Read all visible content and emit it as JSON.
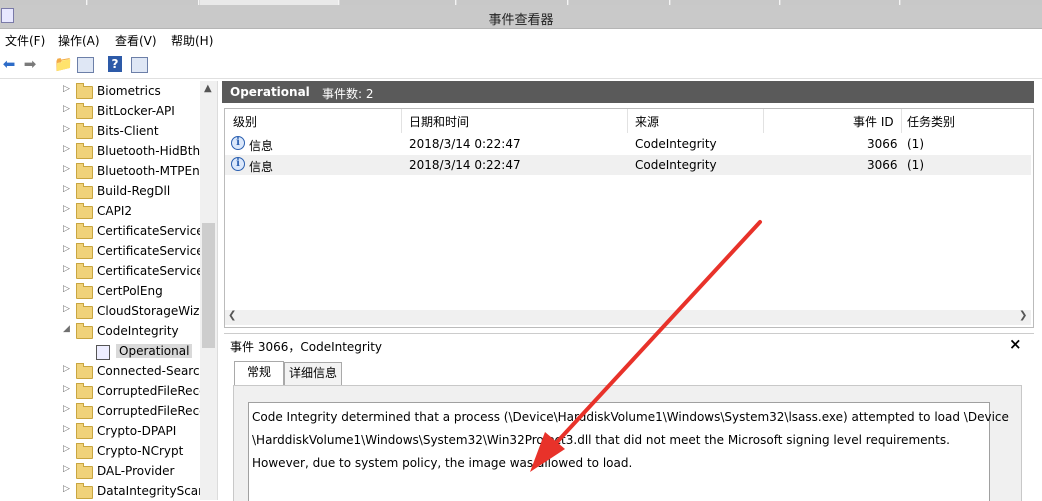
{
  "window": {
    "title": "事件查看器"
  },
  "menu": [
    "文件(F)",
    "操作(A)",
    "查看(V)",
    "帮助(H)"
  ],
  "toolbar": {
    "icons": [
      "back-arrow-icon",
      "forward-arrow-icon",
      "folder-up-icon",
      "properties-icon",
      "help-icon",
      "show-pane-icon"
    ]
  },
  "tree": {
    "items": [
      {
        "label": "Biometrics",
        "expanded": false
      },
      {
        "label": "BitLocker-API",
        "expanded": false
      },
      {
        "label": "Bits-Client",
        "expanded": false
      },
      {
        "label": "Bluetooth-HidBthLE",
        "expanded": false
      },
      {
        "label": "Bluetooth-MTPEnum",
        "expanded": false
      },
      {
        "label": "Build-RegDll",
        "expanded": false
      },
      {
        "label": "CAPI2",
        "expanded": false
      },
      {
        "label": "CertificateServicesClient",
        "expanded": false
      },
      {
        "label": "CertificateServicesClient",
        "expanded": false
      },
      {
        "label": "CertificateServicesClient",
        "expanded": false
      },
      {
        "label": "CertPolEng",
        "expanded": false
      },
      {
        "label": "CloudStorageWizard",
        "expanded": false
      },
      {
        "label": "CodeIntegrity",
        "expanded": true
      },
      {
        "label": "Operational",
        "selected": true
      },
      {
        "label": "Connected-Search",
        "expanded": false
      },
      {
        "label": "CorruptedFileRecovery",
        "expanded": false
      },
      {
        "label": "CorruptedFileRecovery",
        "expanded": false
      },
      {
        "label": "Crypto-DPAPI",
        "expanded": false
      },
      {
        "label": "Crypto-NCrypt",
        "expanded": false
      },
      {
        "label": "DAL-Provider",
        "expanded": false
      },
      {
        "label": "DataIntegrityScan",
        "expanded": false
      }
    ]
  },
  "log": {
    "name": "Operational",
    "count_label": "事件数: 2"
  },
  "columns": [
    "级别",
    "日期和时间",
    "来源",
    "事件 ID",
    "任务类别"
  ],
  "events": [
    {
      "level": "信息",
      "datetime": "2018/3/14 0:22:47",
      "source": "CodeIntegrity",
      "event_id": "3066",
      "category": "(1)"
    },
    {
      "level": "信息",
      "datetime": "2018/3/14 0:22:47",
      "source": "CodeIntegrity",
      "event_id": "3066",
      "category": "(1)"
    }
  ],
  "detail": {
    "title": "事件 3066，CodeIntegrity",
    "close": "×",
    "tabs": [
      "常规",
      "详细信息"
    ],
    "message_lines": [
      "Code Integrity determined that a process (\\Device\\HarddiskVolume1\\Windows\\System32\\lsass.exe) attempted to load \\Device",
      "\\HarddiskVolume1\\Windows\\System32\\Win32Project3.dll that did not meet the Microsoft signing level requirements.",
      "However, due to system policy, the image was allowed to load."
    ]
  },
  "colors": {
    "accent_arrow": "#e8322a",
    "header_bg": "#5a5a5a",
    "selected_bg": "#d9d9d9"
  }
}
